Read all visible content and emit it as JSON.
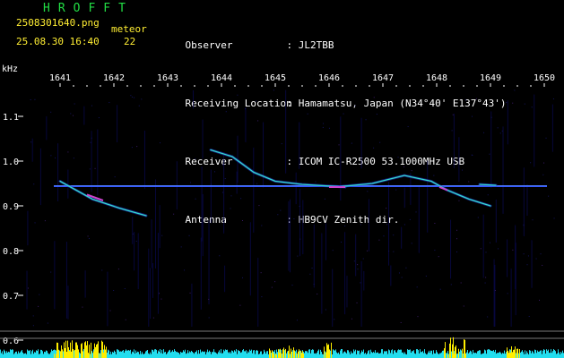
{
  "header": {
    "title": "HROFFT",
    "filename": "2508301640.png",
    "datetime": "25.08.30 16:40",
    "meteor_label": "meteor",
    "meteor_count": "22",
    "info": [
      {
        "key": "Observer",
        "sep": ":",
        "value": "JL2TBB"
      },
      {
        "key": "Receiving Location",
        "sep": ":",
        "value": "Hamamatsu, Japan (N34°40' E137°43')"
      },
      {
        "key": "Receiver",
        "sep": ":",
        "value": "ICOM IC-R2500 53.1000MHz USB"
      },
      {
        "key": "Antenna",
        "sep": ":",
        "value": "HB9CV Zenith dir."
      }
    ]
  },
  "colors": {
    "background": "#000000",
    "title": "#22dd44",
    "meta_text": "#ffee33",
    "axis_text": "#ffffff",
    "carrier_line": "#3355ff",
    "echo_trace": "#33ddcc",
    "level_fill": "#22ddee",
    "level_peak": "#ffee00",
    "gridline": "#777777"
  },
  "chart_data": {
    "type": "heatmap",
    "ylabel": "kHz",
    "x_ticks": [
      "1641",
      "1642",
      "1643",
      "1644",
      "1645",
      "1646",
      "1647",
      "1648",
      "1649",
      "1650"
    ],
    "x_range": [
      1641,
      1650
    ],
    "y_ticks": [
      "1.1",
      "1.0",
      "0.9",
      "0.8",
      "0.7",
      "0.6"
    ],
    "y_range": [
      0.62,
      1.15
    ],
    "carrier_khz": 0.944,
    "traces": [
      {
        "name": "",
        "points": [
          [
            1641.0,
            0.955
          ],
          [
            1641.3,
            0.935
          ],
          [
            1641.6,
            0.915
          ],
          [
            1642.1,
            0.895
          ],
          [
            1642.6,
            0.878
          ]
        ]
      },
      {
        "name": "",
        "points": [
          [
            1643.8,
            1.025
          ],
          [
            1644.2,
            1.01
          ],
          [
            1644.6,
            0.975
          ],
          [
            1645.0,
            0.955
          ],
          [
            1645.5,
            0.948
          ],
          [
            1646.3,
            0.942
          ]
        ]
      },
      {
        "name": "",
        "points": [
          [
            1646.2,
            0.943
          ],
          [
            1646.8,
            0.95
          ],
          [
            1647.4,
            0.968
          ],
          [
            1647.9,
            0.955
          ],
          [
            1648.2,
            0.935
          ],
          [
            1648.6,
            0.915
          ],
          [
            1649.0,
            0.9
          ]
        ]
      },
      {
        "name": "",
        "points": [
          [
            1648.8,
            0.948
          ],
          [
            1649.1,
            0.946
          ]
        ]
      }
    ]
  }
}
